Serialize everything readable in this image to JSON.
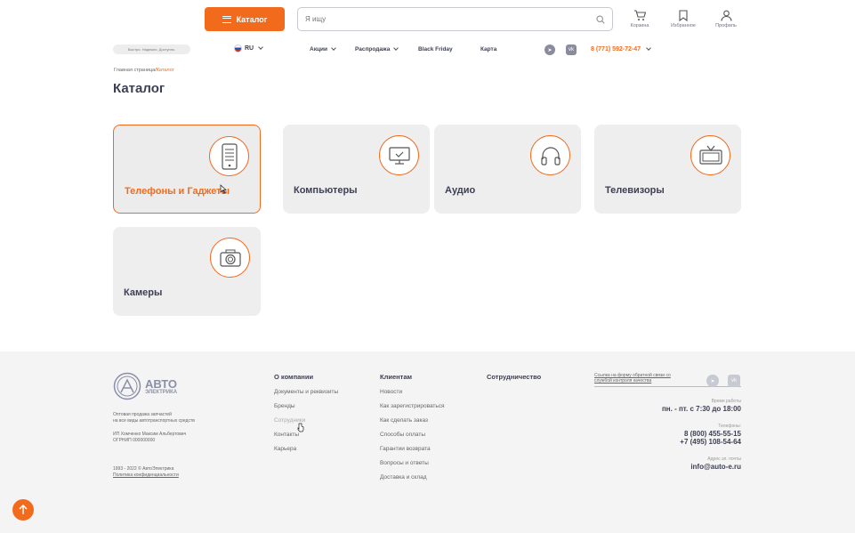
{
  "header": {
    "catalog_label": "Каталог",
    "search_placeholder": "Я ищу",
    "cart_label": "Корзина",
    "favorites_label": "Избранное",
    "profile_label": "Профиль"
  },
  "subheader": {
    "tagline": "Быстро. Надежно. Доступно.",
    "lang": "RU",
    "nav": [
      "Акции",
      "Распродажа",
      "Black Friday",
      "Карта"
    ],
    "phone": "8 (771) 592-72-47"
  },
  "breadcrumb": {
    "home": "Главная страница",
    "sep": "/",
    "current": "Каталог"
  },
  "page_title": "Каталог",
  "categories": [
    {
      "label": "Телефоны и Гаджеты",
      "icon": "phone-icon",
      "active": true
    },
    {
      "label": "Компьютеры",
      "icon": "monitor-icon"
    },
    {
      "label": "Аудио",
      "icon": "headphones-icon"
    },
    {
      "label": "Телевизоры",
      "icon": "tv-icon"
    },
    {
      "label": "Камеры",
      "icon": "camera-icon"
    }
  ],
  "footer": {
    "logo_top": "АВТО",
    "logo_bottom": "ЭЛЕКТРИКА",
    "desc1": "Оптовая продажа запчастей",
    "desc2": "на все виды автотранспортных средств",
    "owner1": "ИП Хомченко Максим Альбертович",
    "owner2": "ОГРНИП 000000000",
    "copyright": "1993 - 2022 © АвтоЭлектрика",
    "privacy": "Политика конфиденциальности",
    "col1_title": "О компании",
    "col1": [
      "Документы и реквизиты",
      "Бренды",
      "Сотрудники",
      "Контакты",
      "Карьера"
    ],
    "col2_title": "Клиентам",
    "col2": [
      "Новости",
      "Как зарегистрироваться",
      "Как сделать заказ",
      "Способы оплаты",
      "Гарантии возврата",
      "Вопросы и ответы",
      "Доставка и склад"
    ],
    "col3_title": "Сотрудничество",
    "feedback1": "Ссылка на форму обратной связи со",
    "feedback2": "службой контроля качества",
    "hours_label": "Время работы",
    "hours": "пн. - пт. с 7:30 до 18:00",
    "phones_label": "Телефоны:",
    "phone1": "8 (800) 455-55-15",
    "phone2": "+7 (495) 108-54-64",
    "email_label": "Адрес эл. почты",
    "email": "info@auto-e.ru"
  },
  "colors": {
    "accent": "#f26b1d",
    "text": "#3d3f52",
    "card_bg": "#eeeeef",
    "footer_bg": "#f4f4f4"
  }
}
